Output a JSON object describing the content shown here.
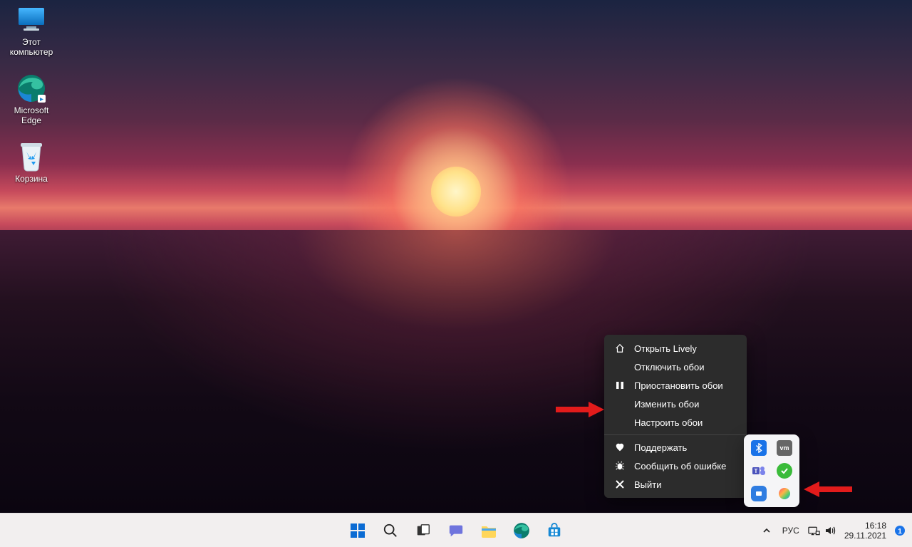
{
  "desktop": {
    "icons": [
      {
        "name": "this-pc",
        "label": "Этот\nкомпьютер"
      },
      {
        "name": "edge",
        "label": "Microsoft\nEdge"
      },
      {
        "name": "recycle-bin",
        "label": "Корзина"
      }
    ]
  },
  "context_menu": {
    "items": [
      {
        "icon": "home-icon",
        "label": "Открыть Lively"
      },
      {
        "icon": "",
        "label": "Отключить обои"
      },
      {
        "icon": "pause-icon",
        "label": "Приостановить обои"
      },
      {
        "icon": "",
        "label": "Изменить обои"
      },
      {
        "icon": "",
        "label": "Настроить обои"
      },
      {
        "icon": "heart-icon",
        "label": "Поддержать"
      },
      {
        "icon": "bug-icon",
        "label": "Сообщить об ошибке"
      },
      {
        "icon": "close-icon",
        "label": "Выйти"
      }
    ]
  },
  "tray_popup": {
    "items": [
      {
        "name": "bluetooth-icon"
      },
      {
        "name": "vmware-icon"
      },
      {
        "name": "teams-icon"
      },
      {
        "name": "shield-ok-icon"
      },
      {
        "name": "app-blue-icon"
      },
      {
        "name": "lively-icon"
      }
    ]
  },
  "taskbar": {
    "center": [
      {
        "name": "start-button"
      },
      {
        "name": "search-button"
      },
      {
        "name": "taskview-button"
      },
      {
        "name": "chat-button"
      },
      {
        "name": "explorer-button"
      },
      {
        "name": "edge-button"
      },
      {
        "name": "store-button"
      }
    ],
    "right": {
      "chevron": "▴",
      "lang": "РУС",
      "time": "16:18",
      "date": "29.11.2021"
    }
  }
}
